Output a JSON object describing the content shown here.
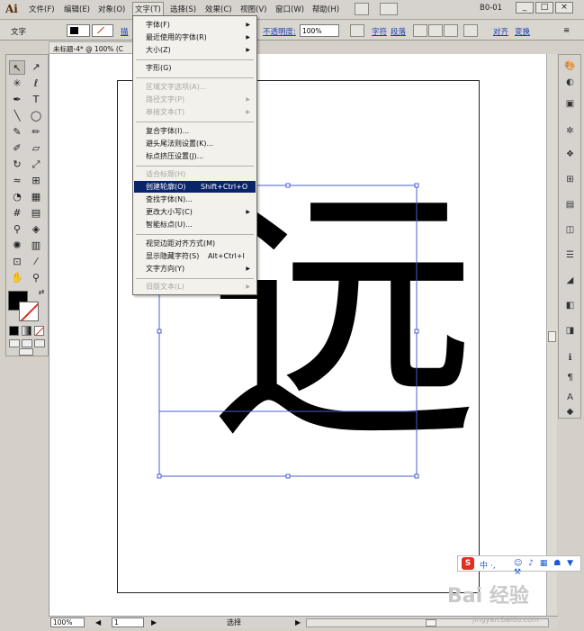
{
  "app": {
    "logo": "Ai",
    "workspace": "B0-01"
  },
  "menubar": {
    "items": [
      "文件(F)",
      "编辑(E)",
      "对象(O)",
      "文字(T)",
      "选择(S)",
      "效果(C)",
      "视图(V)",
      "窗口(W)",
      "帮助(H)"
    ],
    "active": "文字(T)"
  },
  "control_bar": {
    "label": "文字",
    "stroke_link": "描",
    "opacity_label": "不透明度:",
    "opacity_value": "100%",
    "char_link": "字符",
    "para_link": "段落",
    "align_link": "对齐",
    "transform_link": "变换"
  },
  "doc_tab": {
    "title": "未标题-4* @ 100% (C"
  },
  "type_menu": {
    "groups": [
      [
        {
          "label": "字体(F)",
          "submenu": true
        },
        {
          "label": "最近使用的字体(R)",
          "submenu": true
        },
        {
          "label": "大小(Z)",
          "submenu": true
        }
      ],
      [
        {
          "label": "字形(G)"
        }
      ],
      [
        {
          "label": "区域文字选项(A)...",
          "disabled": true
        },
        {
          "label": "路径文字(P)",
          "disabled": true,
          "submenu": true
        },
        {
          "label": "串接文本(T)",
          "disabled": true,
          "submenu": true
        }
      ],
      [
        {
          "label": "复合字体(I)..."
        },
        {
          "label": "避头尾法则设置(K)..."
        },
        {
          "label": "标点挤压设置(J)..."
        }
      ],
      [
        {
          "label": "适合标题(H)",
          "disabled": true
        },
        {
          "label": "创建轮廓(O)",
          "shortcut": "Shift+Ctrl+O",
          "highlighted": true
        },
        {
          "label": "查找字体(N)..."
        },
        {
          "label": "更改大小写(C)",
          "submenu": true
        },
        {
          "label": "智能标点(U)..."
        }
      ],
      [
        {
          "label": "视觉边距对齐方式(M)"
        },
        {
          "label": "显示隐藏字符(S)",
          "shortcut": "Alt+Ctrl+I"
        },
        {
          "label": "文字方向(Y)",
          "submenu": true
        }
      ],
      [
        {
          "label": "旧版文本(L)",
          "disabled": true,
          "submenu": true
        }
      ]
    ]
  },
  "canvas": {
    "glyph": "远"
  },
  "status_bar": {
    "zoom": "100%",
    "page": "1",
    "tool": "选择"
  },
  "overlay": {
    "watermark": "Bai 经验",
    "watermark_sub": "jingyan.baidu.com"
  },
  "colors": {
    "menu_highlight": "#0a246a",
    "selection": "#4a5fd6",
    "accent_red": "#e0301e"
  }
}
